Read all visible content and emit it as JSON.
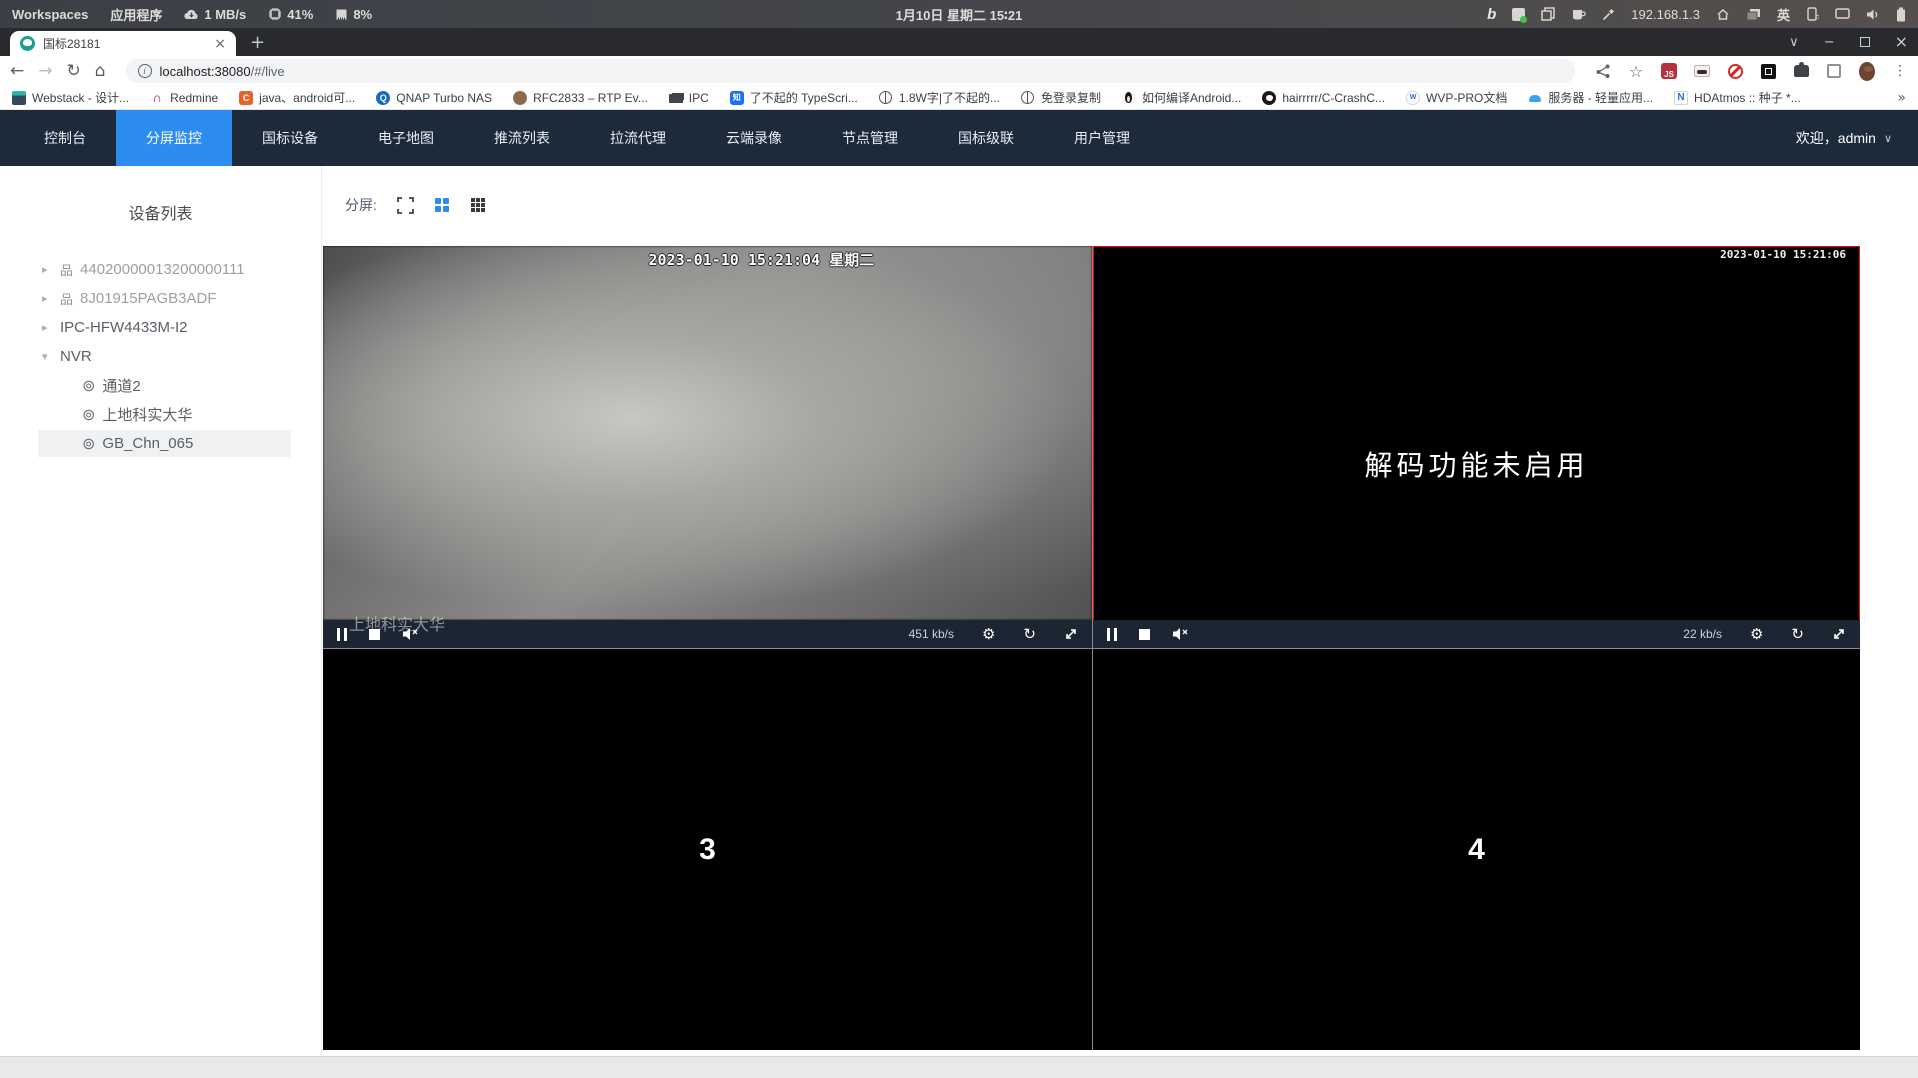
{
  "system_bar": {
    "workspaces": "Workspaces",
    "applications": "应用程序",
    "net_speed": "1 MB/s",
    "cpu": "41%",
    "memory": "8%",
    "clock": "1月10日 星期二 15∶21",
    "ip": "192.168.1.3",
    "ime": "英"
  },
  "browser": {
    "tab_title": "国标28181",
    "url_host": "localhost:38080",
    "url_path": "/#/live",
    "bookmarks": [
      "Webstack - 设计...",
      "Redmine",
      "java、android可...",
      "QNAP Turbo NAS",
      "RFC2833 – RTP Ev...",
      "IPC",
      "了不起的 TypeScri...",
      "1.8W字|了不起的...",
      "免登录复制",
      "如何编译Android...",
      "hairrrrr/C-CrashC...",
      "WVP-PRO文档",
      "服务器 - 轻量应用...",
      "HDAtmos :: 种子 *..."
    ],
    "bookmarks_overflow": "»"
  },
  "app": {
    "nav": [
      "控制台",
      "分屏监控",
      "国标设备",
      "电子地图",
      "推流列表",
      "拉流代理",
      "云端录像",
      "节点管理",
      "国标级联",
      "用户管理"
    ],
    "active_nav": "分屏监控",
    "welcome": "欢迎，admin",
    "sidebar": {
      "title": "设备列表",
      "items": [
        {
          "label": "44020000013200000111"
        },
        {
          "label": "8J01915PAGB3ADF"
        },
        {
          "label": "IPC-HFW4433M-I2"
        },
        {
          "label": "NVR",
          "children": [
            "通道2",
            "上地科实大华",
            "GB_Chn_065"
          ]
        }
      ],
      "selected_channel": "GB_Chn_065"
    },
    "toolbar": {
      "split_label": "分屏:"
    },
    "videos": [
      {
        "timestamp": "2023-01-10 15:21:04 星期二",
        "watermark": "上地科实大华",
        "bitrate": "451 kb/s"
      },
      {
        "timestamp": "2023-01-10 15:21:06",
        "message": "解码功能未启用",
        "bitrate": "22 kb/s"
      },
      {
        "number": "3"
      },
      {
        "number": "4"
      }
    ],
    "colors": {
      "accent": "#2d8cf0",
      "navbar_bg": "#1c2a3a",
      "selected_video_border": "#ff0000"
    },
    "icons": [
      "fullscreen-icon",
      "grid-2x2-icon",
      "grid-3x3-icon",
      "pause-icon",
      "stop-icon",
      "mute-icon",
      "settings-icon",
      "refresh-icon",
      "expand-icon"
    ]
  }
}
